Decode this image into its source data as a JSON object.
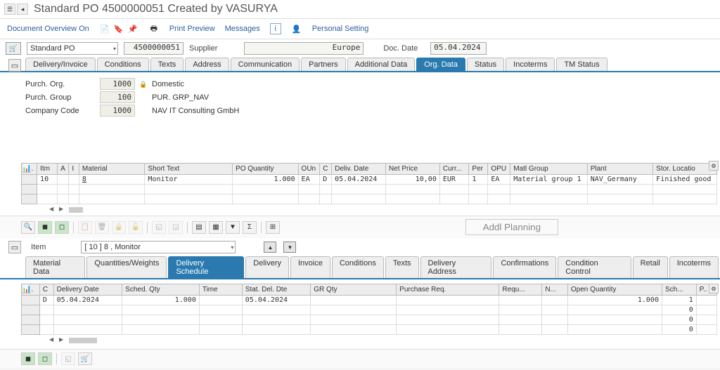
{
  "title": "Standard PO 4500000051 Created by VASURYA",
  "toolbar": {
    "doc_overview": "Document Overview On",
    "print_preview": "Print Preview",
    "messages": "Messages",
    "personal_setting": "Personal Setting"
  },
  "header": {
    "doc_type": "Standard PO",
    "po_number": "4500000051",
    "supplier_lbl": "Supplier",
    "supplier_val": "Europe",
    "doc_date_lbl": "Doc. Date",
    "doc_date": "05.04.2024"
  },
  "header_tabs": [
    "Delivery/Invoice",
    "Conditions",
    "Texts",
    "Address",
    "Communication",
    "Partners",
    "Additional Data",
    "Org. Data",
    "Status",
    "Incoterms",
    "TM Status"
  ],
  "header_tab_active": 7,
  "org": {
    "purch_org_lbl": "Purch. Org.",
    "purch_org_code": "1000",
    "purch_org_desc": "Domestic",
    "purch_group_lbl": "Purch. Group",
    "purch_group_code": "100",
    "purch_group_desc": "PUR. GRP_NAV",
    "company_code_lbl": "Company Code",
    "company_code_code": "1000",
    "company_code_desc": "NAV IT Consulting GmbH"
  },
  "items_cols": [
    "S..",
    "Itm",
    "A",
    "I",
    "Material",
    "Short Text",
    "PO Quantity",
    "OUn",
    "C",
    "Deliv. Date",
    "Net Price",
    "Curr...",
    "Per",
    "OPU",
    "Matl Group",
    "Plant",
    "Stor. Locatio"
  ],
  "items_row": {
    "itm": "10",
    "material": "8",
    "short_text": "Monitor",
    "po_qty": "1.000",
    "oun": "EA",
    "c": "D",
    "deliv_date": "05.04.2024",
    "net_price": "10,00",
    "curr": "EUR",
    "per": "1",
    "opu": "EA",
    "matl_group": "Material group 1",
    "plant": "NAV_Germany",
    "stor_loc": "Finished good"
  },
  "addl_planning": "Addl Planning",
  "item_detail": {
    "label": "Item",
    "value": "[ 10 ] 8 , Monitor"
  },
  "item_tabs": [
    "Material Data",
    "Quantities/Weights",
    "Delivery Schedule",
    "Delivery",
    "Invoice",
    "Conditions",
    "Texts",
    "Delivery Address",
    "Confirmations",
    "Condition Control",
    "Retail",
    "Incoterms"
  ],
  "item_tab_active": 2,
  "sched_cols": [
    "S..",
    "C",
    "Delivery Date",
    "Sched. Qty",
    "Time",
    "Stat. Del. Dte",
    "GR Qty",
    "Purchase Req.",
    "Requ...",
    "N...",
    "Open Quantity",
    "Sch...",
    "P.."
  ],
  "sched_rows": [
    {
      "c": "D",
      "deliv": "05.04.2024",
      "qty": "1.000",
      "stat": "05.04.2024",
      "open": "1.000",
      "sch": "1"
    },
    {
      "open": "",
      "sch": "0"
    },
    {
      "open": "",
      "sch": "0"
    },
    {
      "open": "",
      "sch": "0"
    }
  ]
}
